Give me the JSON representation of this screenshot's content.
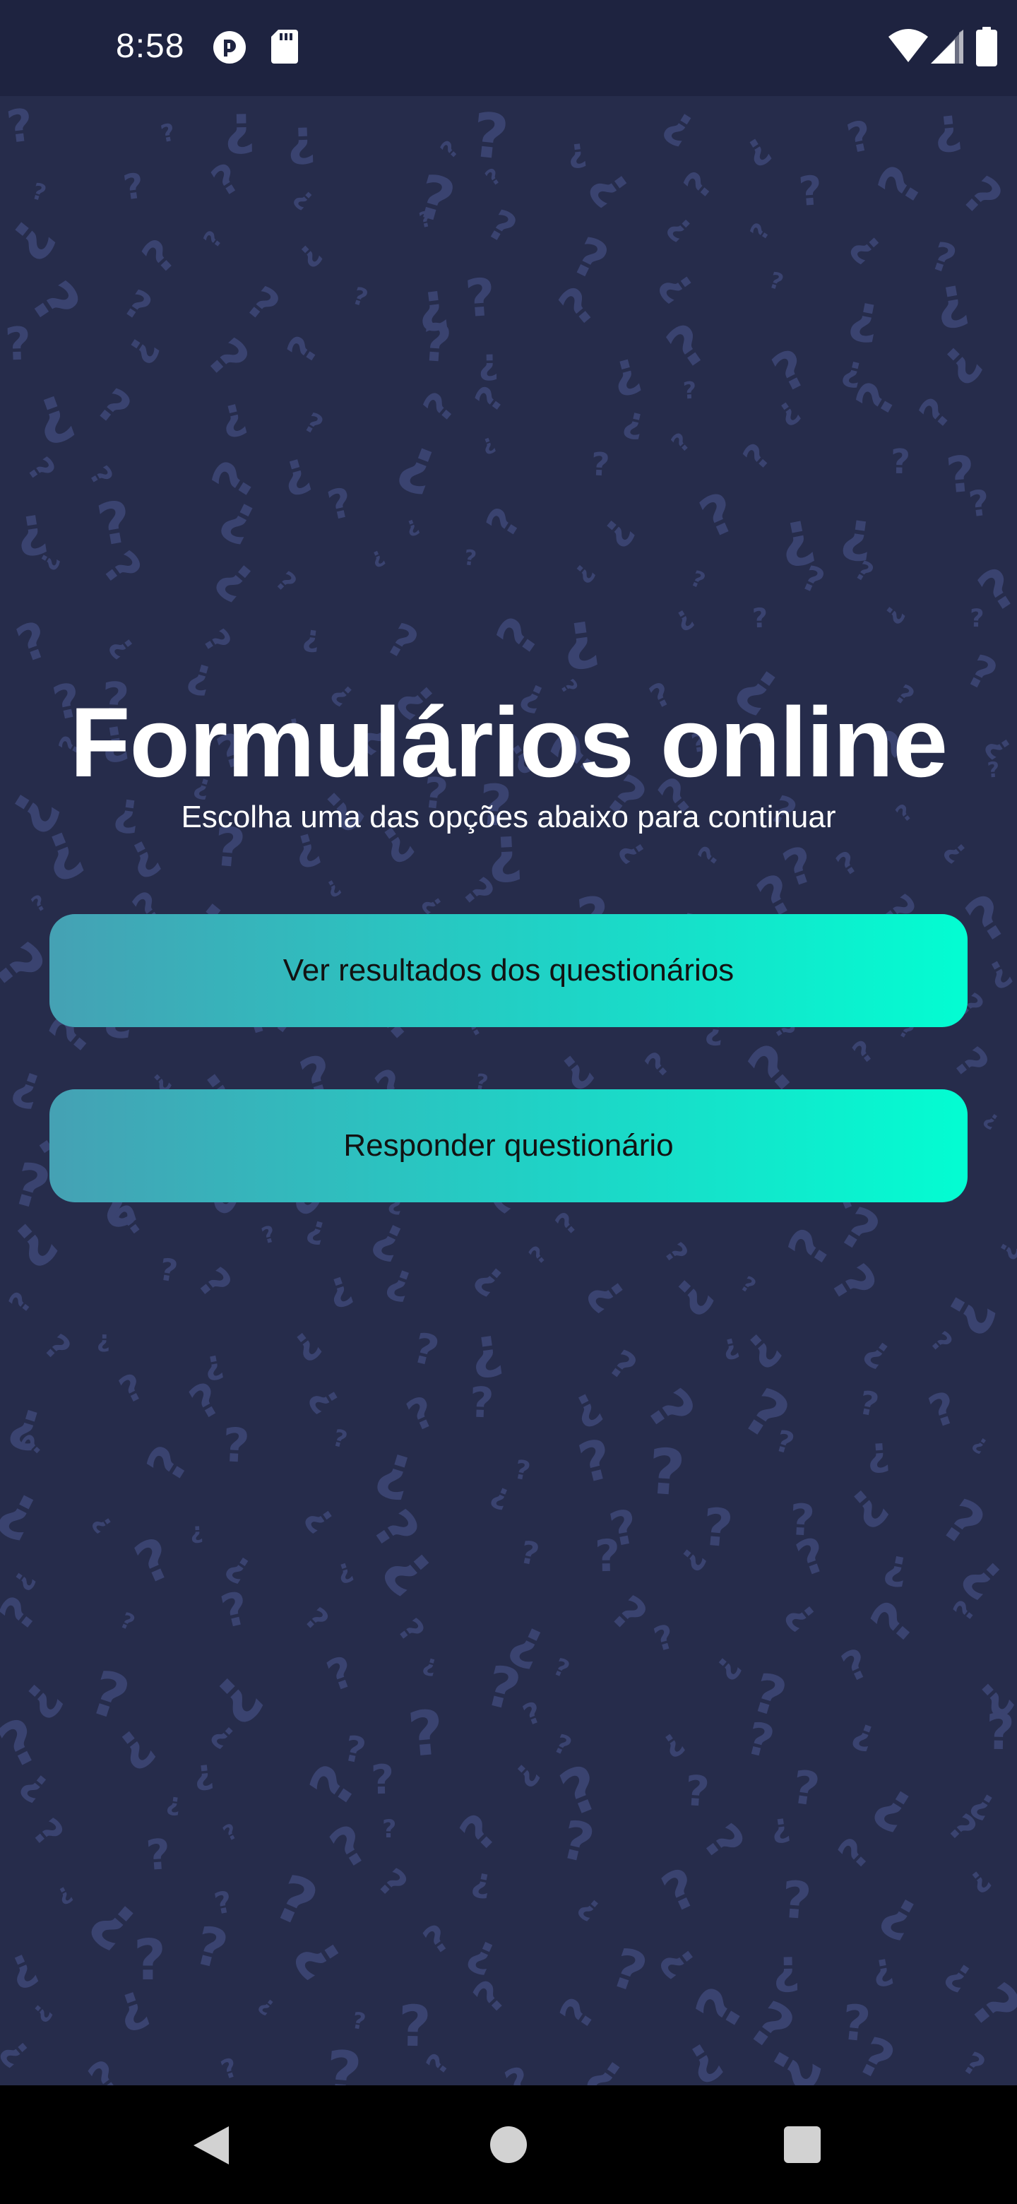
{
  "status_bar": {
    "time": "8:58",
    "icons": [
      "app-notification-icon",
      "sd-card-icon",
      "wifi-icon",
      "signal-icon",
      "battery-icon"
    ]
  },
  "main": {
    "title": "Formulários online",
    "subtitle": "Escolha uma das opções abaixo para continuar",
    "buttons": {
      "results_label": "Ver resultados dos questionários",
      "answer_label": "Responder questionário"
    }
  },
  "navigation_bar": {
    "icons": [
      "back-icon",
      "home-icon",
      "recents-icon"
    ]
  },
  "colors": {
    "background": "#262c4b",
    "pattern": "#3a4370",
    "button_gradient_start": "#45a1b4",
    "button_gradient_end": "#03fdd2",
    "text_primary": "#ffffff",
    "button_text": "#121212"
  }
}
